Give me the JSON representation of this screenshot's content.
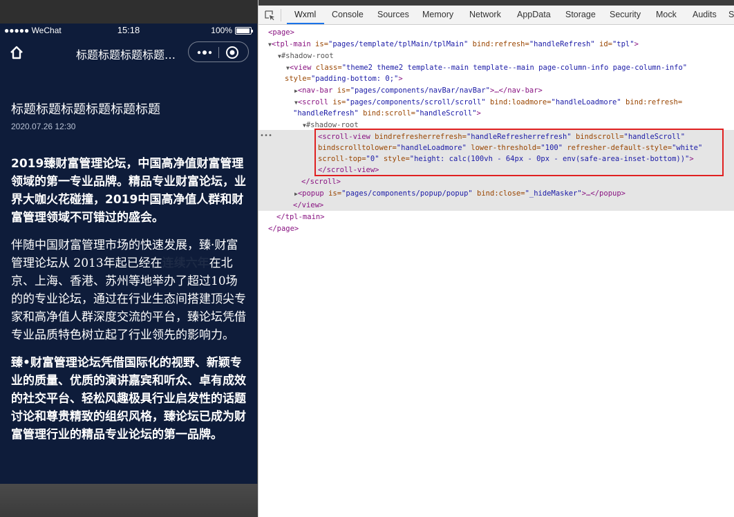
{
  "phone": {
    "status": {
      "carrier": "●●●●● WeChat",
      "time": "15:18",
      "battery": "100%"
    },
    "nav": {
      "title": "标题标题标题标题标题"
    },
    "article": {
      "title": "标题标题标题标题标题标题",
      "date": "2020.07.26 12:30",
      "para1": "2019臻财富管理论坛，中国高净值财富管理领域的第一专业品牌。精品专业财富论坛，业界大咖火花碰撞，2019中国高净值人群和财富管理领域不可错过的盛会。",
      "para2_before": "伴随中国财富管理市场的快速发展，臻·财富管理论坛从 2013年起已经在",
      "para2_highlight": "连续六年",
      "para2_after": "在北京、上海、香港、苏州等地举办了超过10场的的专业论坛，通过在行业生态间搭建顶尖专家和高净值人群深度交流的平台，臻论坛凭借专业品质特色树立起了行业领先的影响力。",
      "para3": "臻•财富管理论坛凭借国际化的视野、新颖专业的质量、优质的演讲嘉宾和听众、卓有成效的社交平台、轻松风趣极具行业启发性的话题讨论和尊贵精致的组织风格，臻论坛已成为财富管理行业的精品专业论坛的第一品牌。"
    },
    "accent_bg": "#0e1c3a"
  },
  "devtools": {
    "tabs": [
      "Wxml",
      "Console",
      "Sources",
      "Memory",
      "Network",
      "AppData",
      "Storage",
      "Security",
      "Mock",
      "Audits",
      "S"
    ],
    "active_tab": "Wxml",
    "tree": {
      "l1": "<page>",
      "l2_tag": "<tpl-main",
      "l2_a1": " is=",
      "l2_v1": "\"pages/template/tplMain/tplMain\"",
      "l2_a2": " bind:refresh=",
      "l2_v2": "\"handleRefresh\"",
      "l2_a3": " id=",
      "l2_v3": "\"tpl\"",
      "l2_end": ">",
      "l3": "#shadow-root",
      "l4_tag": "<view",
      "l4_a1": " class=",
      "l4_v1": "\"theme2 theme2 template--main template--main page-column-info page-column-info\"",
      "l5_a": "style=",
      "l5_v": "\"padding-bottom: 0;\"",
      "l5_end": ">",
      "l6_tag": "<nav-bar",
      "l6_a": " is=",
      "l6_v": "\"pages/components/navBar/navBar\"",
      "l6_end": ">…</nav-bar>",
      "l7_tag": "<scroll",
      "l7_a1": " is=",
      "l7_v1": "\"pages/components/scroll/scroll\"",
      "l7_a2": " bind:loadmore=",
      "l7_v2": "\"handleLoadmore\"",
      "l7_a3": " bind:refresh=",
      "l8_v": "\"handleRefresh\"",
      "l8_a": " bind:scroll=",
      "l8_v2": "\"handleScroll\"",
      "l8_end": ">",
      "l9": "#shadow-root",
      "l10_tag": "<scroll-view",
      "l10_a1": " bindrefresherrefresh=",
      "l10_v1": "\"handleRefresherrefresh\"",
      "l10_a2": " bindscroll=",
      "l10_v2": "\"handleScroll\"",
      "l11_a1": "bindscrolltolower=",
      "l11_v1": "\"handleLoadmore\"",
      "l11_a2": " lower-threshold=",
      "l11_v2": "\"100\"",
      "l11_a3": " refresher-default-style=",
      "l11_v3": "\"white\"",
      "l12_a1": "scroll-top=",
      "l12_v1": "\"0\"",
      "l12_a2": " style=",
      "l12_v2": "\"height: calc(100vh - 64px - 0px - env(safe-area-inset-bottom))\"",
      "l12_end": ">",
      "l13": "</scroll-view>",
      "l14": "</scroll>",
      "l15_tag": "<popup",
      "l15_a1": " is=",
      "l15_v1": "\"pages/components/popup/popup\"",
      "l15_a2": " bind:close=",
      "l15_v2": "\"_hideMasker\"",
      "l15_end": ">…</popup>",
      "l16": "</view>",
      "l17": "</tpl-main>",
      "l18": "</page>"
    }
  }
}
